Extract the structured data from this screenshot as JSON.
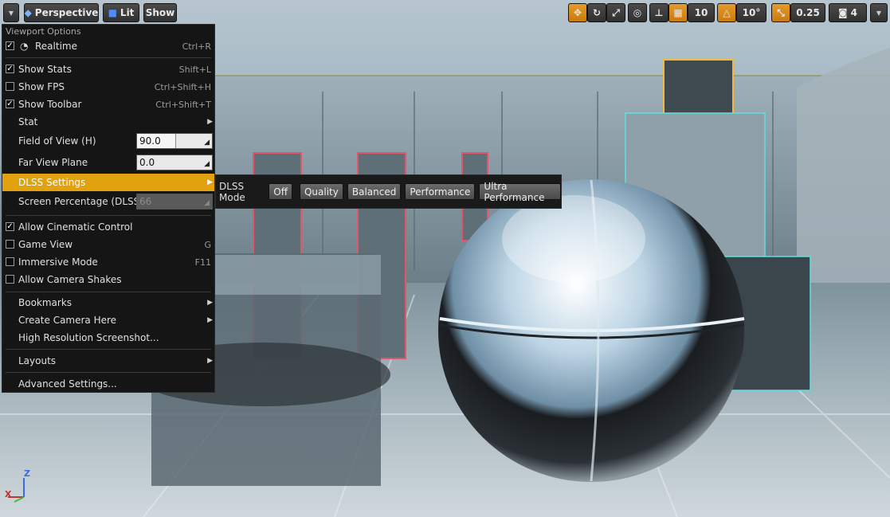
{
  "toolbar": {
    "view_mode": "Perspective",
    "lighting": "Lit",
    "show": "Show",
    "grid_snap": "10",
    "rotation_snap": "10°",
    "scale_snap": "0.25",
    "camera_speed": "4"
  },
  "menu": {
    "title": "Viewport Options",
    "realtime": {
      "label": "Realtime",
      "shortcut": "Ctrl+R"
    },
    "show_stats": {
      "label": "Show Stats",
      "shortcut": "Shift+L"
    },
    "show_fps": {
      "label": "Show FPS",
      "shortcut": "Ctrl+Shift+H"
    },
    "show_toolbar": {
      "label": "Show Toolbar",
      "shortcut": "Ctrl+Shift+T"
    },
    "stat": {
      "label": "Stat"
    },
    "fov": {
      "label": "Field of View (H)",
      "value": "90.0"
    },
    "far_view": {
      "label": "Far View Plane",
      "value": "0.0"
    },
    "dlss_settings": {
      "label": "DLSS Settings"
    },
    "screen_pct": {
      "label": "Screen Percentage (DLSS)",
      "value": "66"
    },
    "cinematic": {
      "label": "Allow Cinematic Control"
    },
    "game_view": {
      "label": "Game View",
      "shortcut": "G"
    },
    "immersive": {
      "label": "Immersive Mode",
      "shortcut": "F11"
    },
    "camera_shakes": {
      "label": "Allow Camera Shakes"
    },
    "bookmarks": {
      "label": "Bookmarks"
    },
    "create_camera": {
      "label": "Create Camera Here"
    },
    "hires": {
      "label": "High Resolution Screenshot..."
    },
    "layouts": {
      "label": "Layouts"
    },
    "advanced": {
      "label": "Advanced Settings..."
    }
  },
  "dlss": {
    "label": "DLSS Mode",
    "options": [
      "Off",
      "Quality",
      "Balanced",
      "Performance",
      "Ultra Performance"
    ]
  },
  "axis": {
    "z": "Z",
    "x": "X"
  },
  "colors": {
    "accent": "#e2a20f",
    "menu_bg": "#151515"
  }
}
